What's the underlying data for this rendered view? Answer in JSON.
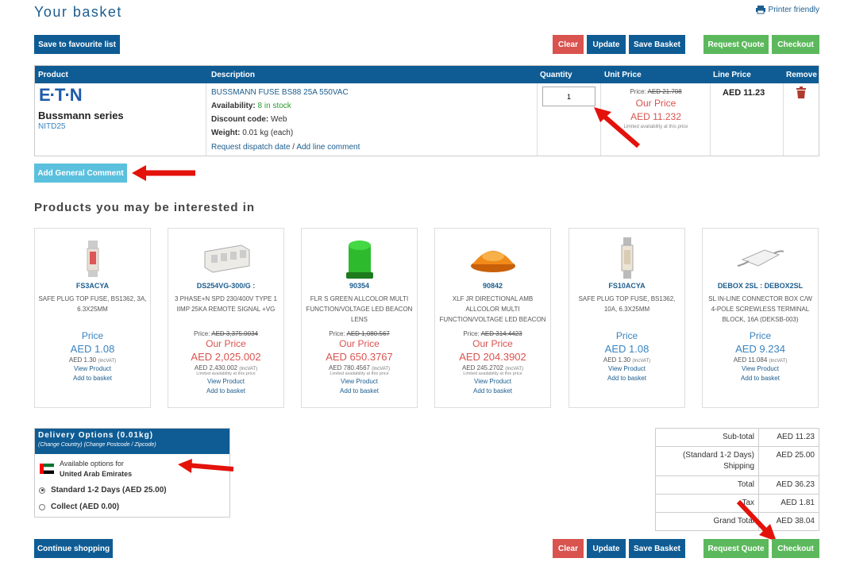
{
  "header": {
    "title": "Your basket",
    "printer_label": "Printer friendly"
  },
  "toolbar": {
    "save_fav": "Save to favourite list",
    "clear": "Clear",
    "update": "Update",
    "save_basket": "Save Basket",
    "request_quote": "Request Quote",
    "checkout": "Checkout",
    "continue": "Continue shopping",
    "add_comment": "Add General Comment"
  },
  "table": {
    "headers": [
      "Product",
      "Description",
      "Quantity",
      "Unit Price",
      "Line Price",
      "Remove"
    ],
    "item": {
      "logo_text": "E·T·N",
      "brand": "Bussmann series",
      "sku": "NITD25",
      "name": "BUSSMANN FUSE BS88 25A 550VAC",
      "availability_label": "Availability:",
      "availability_value": "8 in stock",
      "discount_label": "Discount code:",
      "discount_value": "Web",
      "weight_label": "Weight:",
      "weight_value": "0.01 kg (each)",
      "dispatch_link": "Request dispatch date",
      "separator": "/",
      "comment_link": "Add line comment",
      "quantity": "1",
      "was_label": "Price:",
      "was_price": "AED 21.708",
      "our_price_label": "Our Price",
      "our_price": "AED 11.232",
      "limited": "Limited availability at this price",
      "line_price": "AED 11.23"
    }
  },
  "recommendations": {
    "title": "Products you may be interested in",
    "items": [
      {
        "code": "FS3ACYA",
        "desc": "SAFE PLUG TOP FUSE, BS1362, 3A, 6.3X25MM",
        "price_label": "Price",
        "price": "AED 1.08",
        "vat": "AED 1.30",
        "vat_tag": "(IncVAT)",
        "view": "View Product",
        "add": "Add to basket"
      },
      {
        "code": "DS254VG-300/G :",
        "desc": "3 PHASE+N SPD 230/400V TYPE 1 IIMP 25KA REMOTE SIGNAL +VG",
        "was_label": "Price:",
        "was": "AED 3,375.0034",
        "our_label": "Our Price",
        "price": "AED 2,025.002",
        "vat": "AED 2,430.002",
        "vat_tag": "(IncVAT)",
        "limited": "Limited availability at this price",
        "view": "View Product",
        "add": "Add to basket"
      },
      {
        "code": "90354",
        "desc": "FLR S GREEN ALLCOLOR MULTI FUNCTION/VOLTAGE LED BEACON LENS",
        "was_label": "Price:",
        "was": "AED 1,080.567",
        "our_label": "Our Price",
        "price": "AED 650.3767",
        "vat": "AED 780.4567",
        "vat_tag": "(IncVAT)",
        "limited": "Limited availability at this price",
        "view": "View Product",
        "add": "Add to basket"
      },
      {
        "code": "90842",
        "desc": "XLF JR DIRECTIONAL AMB ALLCOLOR MULTI FUNCTION/VOLTAGE LED BEACON",
        "was_label": "Price:",
        "was": "AED 314.4423",
        "our_label": "Our Price",
        "price": "AED 204.3902",
        "vat": "AED 245.2702",
        "vat_tag": "(IncVAT)",
        "limited": "Limited availability at this price",
        "view": "View Product",
        "add": "Add to basket"
      },
      {
        "code": "FS10ACYA",
        "desc": "SAFE PLUG TOP FUSE, BS1362, 10A, 6.3X25MM",
        "price_label": "Price",
        "price": "AED 1.08",
        "vat": "AED 1.30",
        "vat_tag": "(IncVAT)",
        "view": "View Product",
        "add": "Add to basket"
      },
      {
        "code": "DEBOX 2SL : DEBOX2SL",
        "desc": "SL IN-LINE CONNECTOR BOX C/W 4-POLE SCREWLESS TERMINAL BLOCK, 16A (DEKSB-003)",
        "price_label": "Price",
        "price": "AED 9.234",
        "vat": "AED 11.084",
        "vat_tag": "(IncVAT)",
        "view": "View Product",
        "add": "Add to basket"
      }
    ]
  },
  "delivery": {
    "title": "Delivery Options (0.01kg)",
    "change_country": "(Change Country)",
    "change_postcode": "(Change Postcode / Zipcode)",
    "available_for": "Available options for",
    "country": "United Arab Emirates",
    "options": [
      "Standard 1-2 Days (AED 25.00)",
      "Collect (AED 0.00)"
    ]
  },
  "totals": {
    "rows": [
      {
        "label": "Sub-total",
        "value": "AED 11.23"
      },
      {
        "label": "(Standard 1-2 Days) Shipping",
        "value": "AED 25.00"
      },
      {
        "label": "Total",
        "value": "AED 36.23"
      },
      {
        "label": "Tax",
        "value": "AED 1.81"
      },
      {
        "label": "Grand Total",
        "value": "AED 38.04"
      }
    ]
  },
  "colors": {
    "primary": "#0f5c94",
    "danger": "#d9534f",
    "success": "#5cb85c",
    "info": "#5bc0de"
  }
}
